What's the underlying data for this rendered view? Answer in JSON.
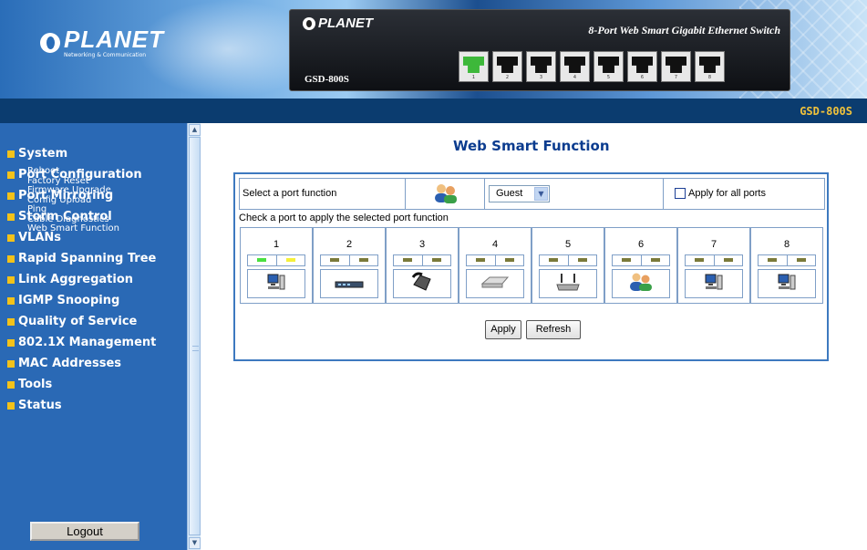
{
  "header": {
    "logo_name": "PLANET",
    "logo_tagline": "Networking & Communication",
    "device_logo": "PLANET",
    "device_model": "GSD-800S",
    "device_title": "8-Port Web Smart Gigabit Ethernet Switch",
    "port_numbers": [
      "1",
      "2",
      "3",
      "4",
      "5",
      "6",
      "7",
      "8"
    ],
    "model_label": "GSD-800S"
  },
  "sidebar": {
    "items": [
      {
        "label": "System"
      },
      {
        "label": "Port Configuration"
      },
      {
        "label": "Port Mirroring"
      },
      {
        "label": "Storm Control"
      },
      {
        "label": "VLANs"
      },
      {
        "label": "Rapid Spanning Tree"
      },
      {
        "label": "Link Aggregation"
      },
      {
        "label": "IGMP Snooping"
      },
      {
        "label": "Quality of Service"
      },
      {
        "label": "802.1X Management"
      },
      {
        "label": "MAC Addresses"
      },
      {
        "label": "Tools"
      }
    ],
    "tools_submenu": [
      "Reboot",
      "Factory Reset",
      "Firmware Upgrade",
      "Config Upload",
      "Ping",
      "Cable Diagnostics",
      "Web Smart Function"
    ],
    "status_label": "Status",
    "logout_label": "Logout"
  },
  "main": {
    "title": "Web Smart Function",
    "select_label": "Select a port function",
    "selected_function": "Guest",
    "apply_all_label": "Apply for all ports",
    "check_label": "Check a port to apply the selected port function",
    "ports": [
      {
        "number": "1",
        "device": "pc-icon",
        "led_left": "#49e040",
        "led_right": "#f5f03a"
      },
      {
        "number": "2",
        "device": "switch-icon"
      },
      {
        "number": "3",
        "device": "phone-icon"
      },
      {
        "number": "4",
        "device": "router-icon"
      },
      {
        "number": "5",
        "device": "access-point-icon"
      },
      {
        "number": "6",
        "device": "guest-icon"
      },
      {
        "number": "7",
        "device": "pc-icon"
      },
      {
        "number": "8",
        "device": "pc-icon"
      }
    ],
    "apply_label": "Apply",
    "refresh_label": "Refresh"
  }
}
